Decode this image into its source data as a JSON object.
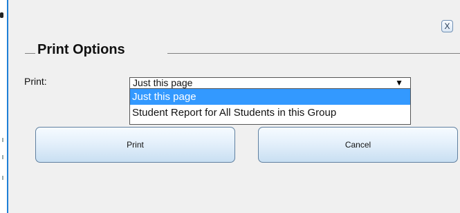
{
  "dialog": {
    "close_label": "X",
    "title": "Print Options",
    "print_label": "Print:",
    "select": {
      "value": "Just this page",
      "arrow": "▼",
      "options": [
        "Just this page",
        "Student Report for All Students in this Group"
      ],
      "highlighted_option": "Just this page"
    },
    "buttons": {
      "print": "Print",
      "cancel": "Cancel"
    }
  },
  "colors": {
    "dialog_bg": "#f0f0f0",
    "highlight": "#3399ff",
    "left_border": "#1e7fd6",
    "button_border": "#5f7f9f"
  },
  "icons": {
    "close": "close-icon",
    "dropdown": "chevron-down-icon"
  }
}
